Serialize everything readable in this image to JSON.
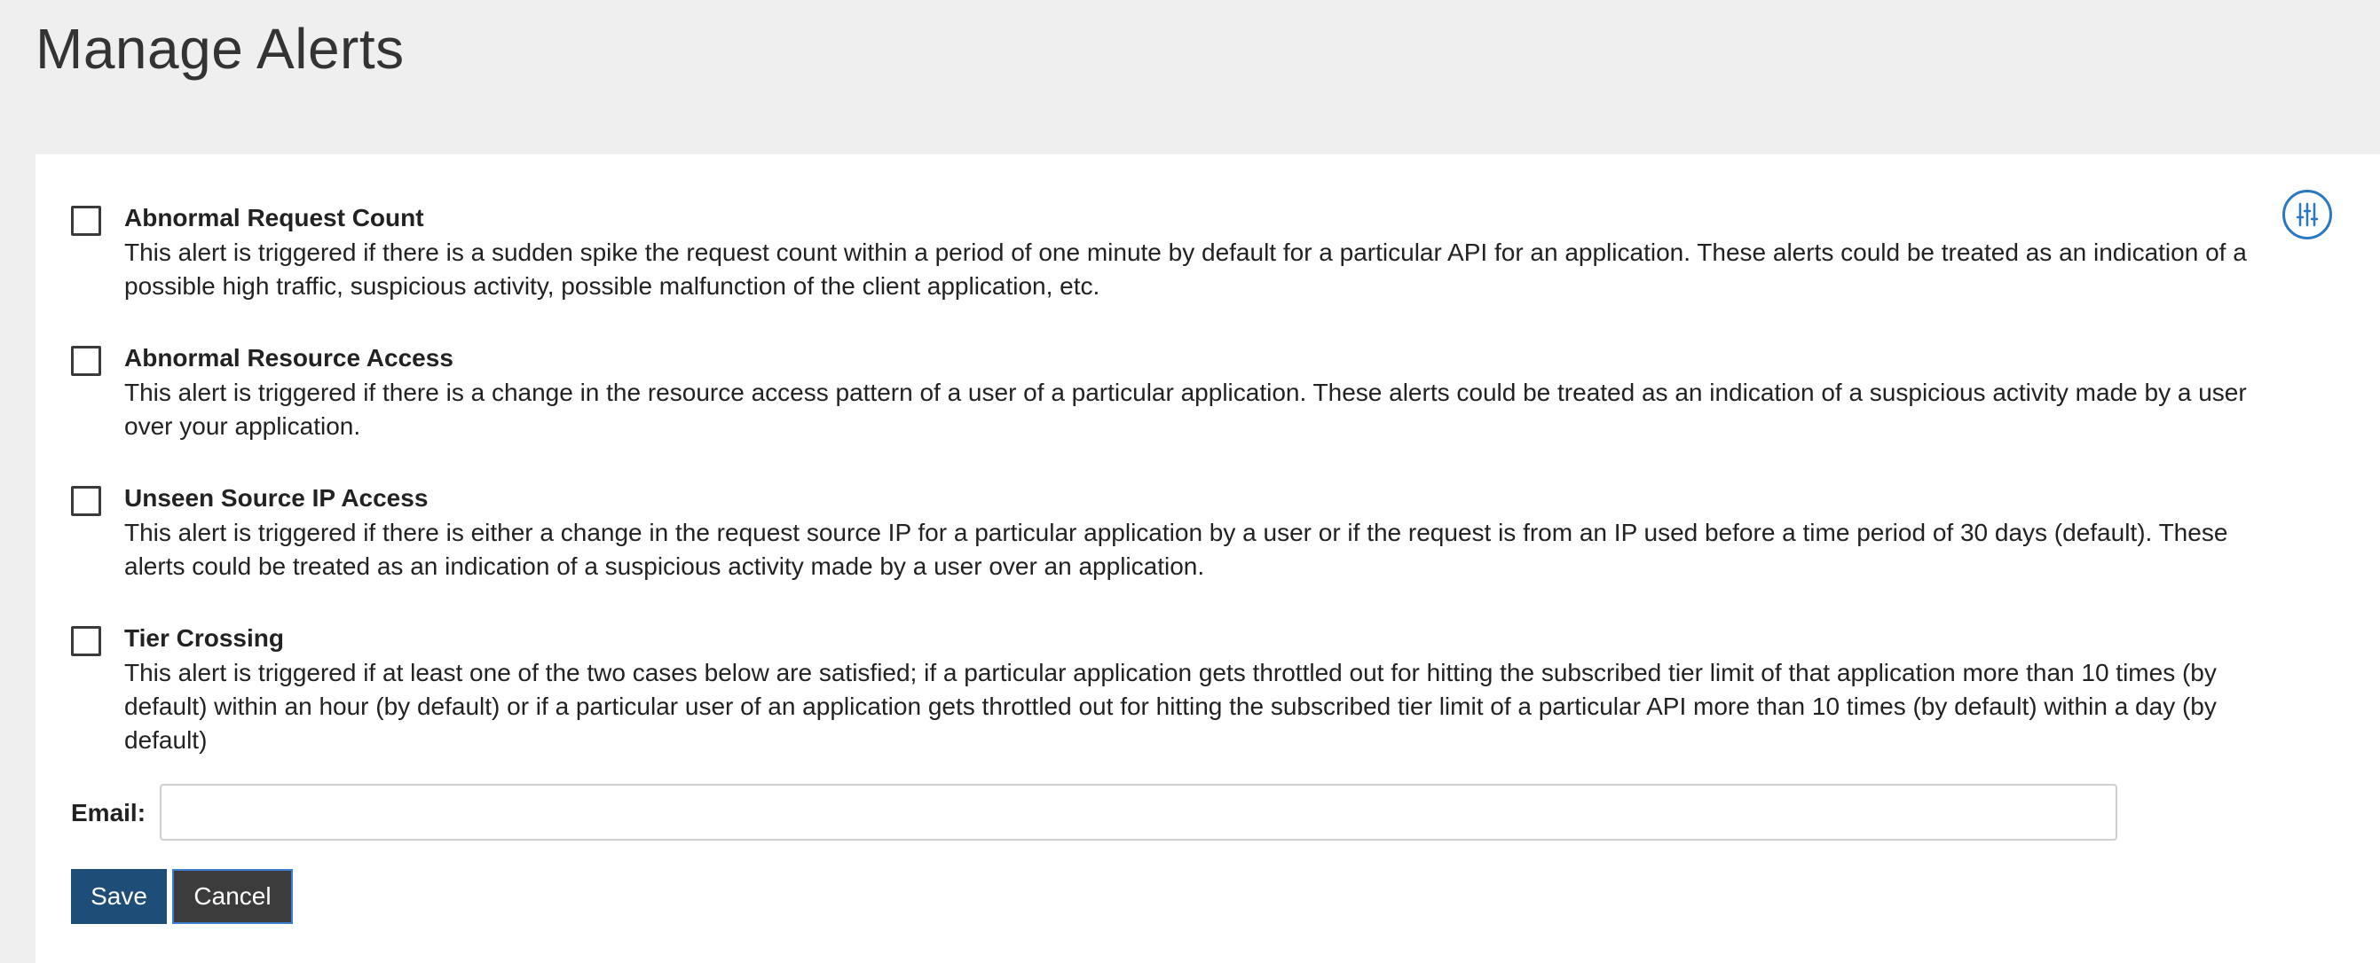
{
  "page": {
    "title": "Manage Alerts"
  },
  "alerts": [
    {
      "title": "Abnormal Request Count",
      "description": "This alert is triggered if there is a sudden spike the request count within a period of one minute by default for a particular API for an application. These alerts could be treated as an indication of a possible high traffic, suspicious activity, possible malfunction of the client application, etc.",
      "checked": false
    },
    {
      "title": "Abnormal Resource Access",
      "description": "This alert is triggered if there is a change in the resource access pattern of a user of a particular application. These alerts could be treated as an indication of a suspicious activity made by a user over your application.",
      "checked": false
    },
    {
      "title": "Unseen Source IP Access",
      "description": "This alert is triggered if there is either a change in the request source IP for a particular application by a user or if the request is from an IP used before a time period of 30 days (default). These alerts could be treated as an indication of a suspicious activity made by a user over an application.",
      "checked": false
    },
    {
      "title": "Tier Crossing",
      "description": "This alert is triggered if at least one of the two cases below are satisfied; if a particular application gets throttled out for hitting the subscribed tier limit of that application more than 10 times (by default) within an hour (by default) or if a particular user of an application gets throttled out for hitting the subscribed tier limit of a particular API more than 10 times (by default) within a day (by default)",
      "checked": false
    }
  ],
  "form": {
    "email_label": "Email:",
    "email_value": "",
    "email_placeholder": "",
    "save_label": "Save",
    "cancel_label": "Cancel"
  },
  "icons": {
    "settings": "sliders-icon"
  },
  "colors": {
    "save_button": "#1e4d78",
    "cancel_button": "#3c3c3c",
    "accent": "#2a78c2"
  }
}
